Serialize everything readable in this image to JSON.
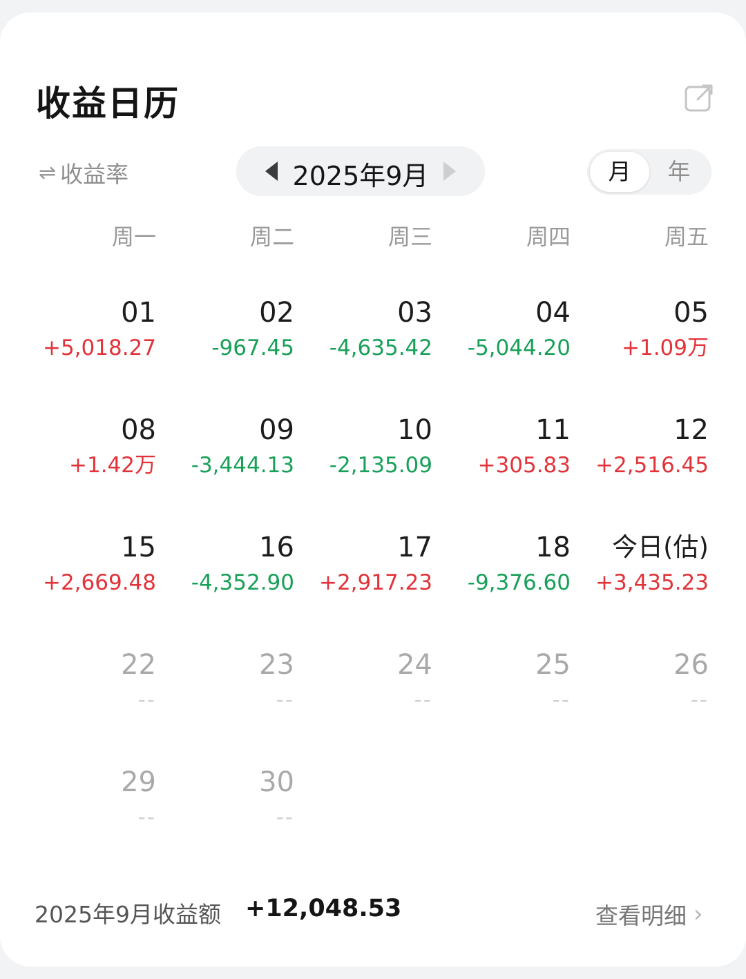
{
  "header": {
    "title": "收益日历",
    "share_icon": "external-link-icon"
  },
  "controls": {
    "rate_toggle_icon": "⇌",
    "rate_toggle_label": "收益率",
    "month_label": "2025年9月",
    "segments": {
      "month": "月",
      "year": "年",
      "selected": "月"
    }
  },
  "weekdays": [
    "周一",
    "周二",
    "周三",
    "周四",
    "周五"
  ],
  "calendar": {
    "weeks": [
      [
        {
          "day": "01",
          "value": "+5,018.27",
          "trend": "pos"
        },
        {
          "day": "02",
          "value": "-967.45",
          "trend": "neg"
        },
        {
          "day": "03",
          "value": "-4,635.42",
          "trend": "neg"
        },
        {
          "day": "04",
          "value": "-5,044.20",
          "trend": "neg"
        },
        {
          "day": "05",
          "value": "+1.09万",
          "trend": "pos"
        }
      ],
      [
        {
          "day": "08",
          "value": "+1.42万",
          "trend": "pos"
        },
        {
          "day": "09",
          "value": "-3,444.13",
          "trend": "neg"
        },
        {
          "day": "10",
          "value": "-2,135.09",
          "trend": "neg"
        },
        {
          "day": "11",
          "value": "+305.83",
          "trend": "pos"
        },
        {
          "day": "12",
          "value": "+2,516.45",
          "trend": "pos"
        }
      ],
      [
        {
          "day": "15",
          "value": "+2,669.48",
          "trend": "pos"
        },
        {
          "day": "16",
          "value": "-4,352.90",
          "trend": "neg"
        },
        {
          "day": "17",
          "value": "+2,917.23",
          "trend": "pos"
        },
        {
          "day": "18",
          "value": "-9,376.60",
          "trend": "neg"
        },
        {
          "day": "今日(估)",
          "value": "+3,435.23",
          "trend": "pos",
          "today": true
        }
      ],
      [
        {
          "day": "22",
          "value": "--",
          "trend": "none",
          "future": true
        },
        {
          "day": "23",
          "value": "--",
          "trend": "none",
          "future": true
        },
        {
          "day": "24",
          "value": "--",
          "trend": "none",
          "future": true
        },
        {
          "day": "25",
          "value": "--",
          "trend": "none",
          "future": true
        },
        {
          "day": "26",
          "value": "--",
          "trend": "none",
          "future": true
        }
      ],
      [
        {
          "day": "29",
          "value": "--",
          "trend": "none",
          "future": true
        },
        {
          "day": "30",
          "value": "--",
          "trend": "none",
          "future": true
        }
      ]
    ]
  },
  "footer": {
    "total_label": "2025年9月收益额",
    "total_value": "+12,048.53",
    "detail_label": "查看明细",
    "detail_icon": "chevron-right-icon"
  },
  "colors": {
    "positive": "#e2333a",
    "negative": "#18a058",
    "muted": "#a9a9a9"
  }
}
